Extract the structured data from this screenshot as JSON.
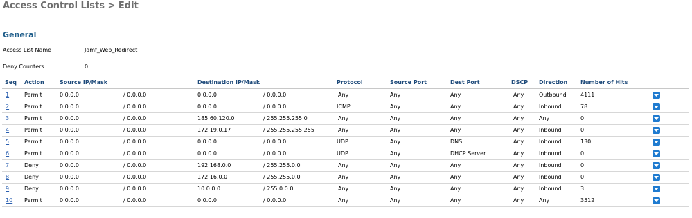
{
  "header": {
    "title": "Access Control Lists > Edit"
  },
  "general": {
    "section_title": "General",
    "access_list_name_label": "Access List Name",
    "access_list_name_value": "Jamf_Web_Redirect",
    "deny_counters_label": "Deny Counters",
    "deny_counters_value": "0"
  },
  "table": {
    "columns": {
      "seq": "Seq",
      "action": "Action",
      "source": "Source IP/Mask",
      "destination": "Destination IP/Mask",
      "protocol": "Protocol",
      "source_port": "Source Port",
      "dest_port": "Dest Port",
      "dscp": "DSCP",
      "direction": "Direction",
      "hits": "Number of Hits"
    },
    "rows": [
      {
        "seq": "1",
        "action": "Permit",
        "src_ip": "0.0.0.0",
        "src_mask": "/ 0.0.0.0",
        "dst_ip": "0.0.0.0",
        "dst_mask": "/ 0.0.0.0",
        "protocol": "Any",
        "src_port": "Any",
        "dst_port": "Any",
        "dscp": "Any",
        "direction": "Outbound",
        "hits": "4111"
      },
      {
        "seq": "2",
        "action": "Permit",
        "src_ip": "0.0.0.0",
        "src_mask": "/ 0.0.0.0",
        "dst_ip": "0.0.0.0",
        "dst_mask": "/ 0.0.0.0",
        "protocol": "ICMP",
        "src_port": "Any",
        "dst_port": "Any",
        "dscp": "Any",
        "direction": "Inbound",
        "hits": "78"
      },
      {
        "seq": "3",
        "action": "Permit",
        "src_ip": "0.0.0.0",
        "src_mask": "/ 0.0.0.0",
        "dst_ip": "185.60.120.0",
        "dst_mask": "/ 255.255.255.0",
        "protocol": "Any",
        "src_port": "Any",
        "dst_port": "Any",
        "dscp": "Any",
        "direction": "Any",
        "hits": "0"
      },
      {
        "seq": "4",
        "action": "Permit",
        "src_ip": "0.0.0.0",
        "src_mask": "/ 0.0.0.0",
        "dst_ip": "172.19.0.17",
        "dst_mask": "/ 255.255.255.255",
        "protocol": "Any",
        "src_port": "Any",
        "dst_port": "Any",
        "dscp": "Any",
        "direction": "Inbound",
        "hits": "0"
      },
      {
        "seq": "5",
        "action": "Permit",
        "src_ip": "0.0.0.0",
        "src_mask": "/ 0.0.0.0",
        "dst_ip": "0.0.0.0",
        "dst_mask": "/ 0.0.0.0",
        "protocol": "UDP",
        "src_port": "Any",
        "dst_port": "DNS",
        "dscp": "Any",
        "direction": "Inbound",
        "hits": "130"
      },
      {
        "seq": "6",
        "action": "Permit",
        "src_ip": "0.0.0.0",
        "src_mask": "/ 0.0.0.0",
        "dst_ip": "0.0.0.0",
        "dst_mask": "/ 0.0.0.0",
        "protocol": "UDP",
        "src_port": "Any",
        "dst_port": "DHCP Server",
        "dscp": "Any",
        "direction": "Inbound",
        "hits": "0"
      },
      {
        "seq": "7",
        "action": "Deny",
        "src_ip": "0.0.0.0",
        "src_mask": "/ 0.0.0.0",
        "dst_ip": "192.168.0.0",
        "dst_mask": "/ 255.255.0.0",
        "protocol": "Any",
        "src_port": "Any",
        "dst_port": "Any",
        "dscp": "Any",
        "direction": "Inbound",
        "hits": "0"
      },
      {
        "seq": "8",
        "action": "Deny",
        "src_ip": "0.0.0.0",
        "src_mask": "/ 0.0.0.0",
        "dst_ip": "172.16.0.0",
        "dst_mask": "/ 255.255.0.0",
        "protocol": "Any",
        "src_port": "Any",
        "dst_port": "Any",
        "dscp": "Any",
        "direction": "Inbound",
        "hits": "0"
      },
      {
        "seq": "9",
        "action": "Deny",
        "src_ip": "0.0.0.0",
        "src_mask": "/ 0.0.0.0",
        "dst_ip": "10.0.0.0",
        "dst_mask": "/ 255.0.0.0",
        "protocol": "Any",
        "src_port": "Any",
        "dst_port": "Any",
        "dscp": "Any",
        "direction": "Inbound",
        "hits": "3"
      },
      {
        "seq": "10",
        "action": "Permit",
        "src_ip": "0.0.0.0",
        "src_mask": "/ 0.0.0.0",
        "dst_ip": "0.0.0.0",
        "dst_mask": "/ 0.0.0.0",
        "protocol": "Any",
        "src_port": "Any",
        "dst_port": "Any",
        "dscp": "Any",
        "direction": "Any",
        "hits": "3512"
      }
    ],
    "row_menu_icon": "chevron-down-icon"
  },
  "colors": {
    "title_gray": "#6e6e6e",
    "section_blue": "#1e5d8a",
    "header_blue": "#1e4a7a",
    "link_blue": "#2a5fb0",
    "dropdown_blue": "#1f7bd0"
  }
}
